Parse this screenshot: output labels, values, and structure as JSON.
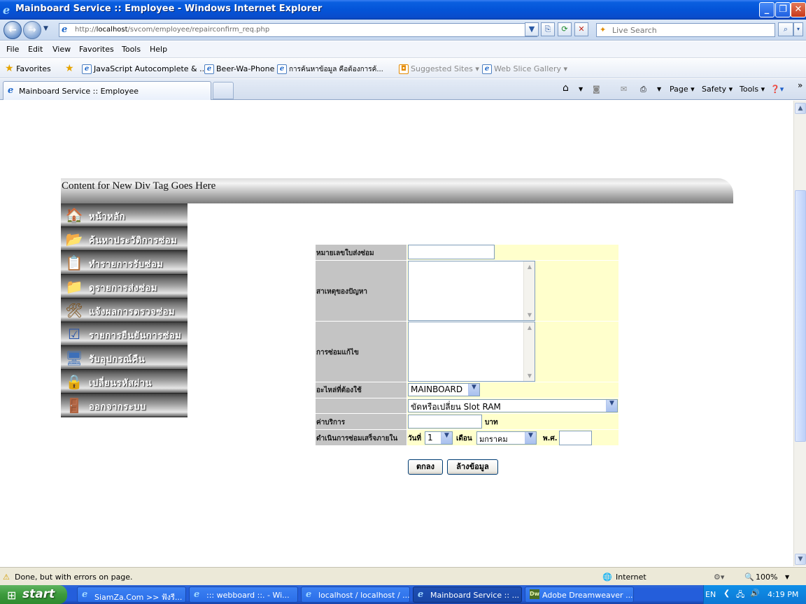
{
  "window": {
    "title": "Mainboard Service :: Employee - Windows Internet Explorer",
    "controls": [
      "minimize",
      "maximize",
      "close"
    ]
  },
  "address_bar": {
    "url_prefix": "http://",
    "url_host": "localhost",
    "url_path": "/svcom/employee/repairconfirm_req.php",
    "search_placeholder": "Live Search"
  },
  "menu": [
    "File",
    "Edit",
    "View",
    "Favorites",
    "Tools",
    "Help"
  ],
  "favorites_bar": {
    "favorites_label": "Favorites",
    "items": [
      "JavaScript Autocomplete & ...",
      "Beer-Wa-Phone",
      "การค้นหาข้อมูล คือต้องการค้...",
      "Suggested Sites ▾",
      "Web Slice Gallery ▾"
    ]
  },
  "tab": {
    "title": "Mainboard Service :: Employee"
  },
  "command_bar": [
    "Page ▾",
    "Safety ▾",
    "Tools ▾"
  ],
  "page": {
    "header_text": "Content for New Div Tag Goes Here",
    "side_menu": [
      {
        "label": "หน้าหลัก",
        "icon": "home-icon"
      },
      {
        "label": "ค้นหาประวัติการซ่อม",
        "icon": "folder-search-icon"
      },
      {
        "label": "ทำรายการรับซ่อม",
        "icon": "document-icon"
      },
      {
        "label": "ดูรายการส่งซ่อม",
        "icon": "open-folder-icon"
      },
      {
        "label": "แจ้งผลการตรวจซ่อม",
        "icon": "tools-icon"
      },
      {
        "label": "รายการยืนยันการซ่อม",
        "icon": "checklist-icon"
      },
      {
        "label": "รับอุปกรณ์คืน",
        "icon": "computer-icon"
      },
      {
        "label": "เปลี่ยนรหัสผ่าน",
        "icon": "lock-icon"
      },
      {
        "label": "ออกจากระบบ",
        "icon": "exit-door-icon"
      }
    ],
    "form": {
      "labels": {
        "repair_no": "หมายเลขใบส่งซ่อม",
        "cause": "สาเหตุของปัญหา",
        "fix": "การซ่อมแก้ไข",
        "parts": "อะไหล่ที่ต้องใช้",
        "service_fee": "ค่าบริการ",
        "complete_within": "ดำเนินการซ่อมเสร็จภายใน"
      },
      "values": {
        "repair_no": "",
        "cause": "",
        "fix": "",
        "service_fee": ""
      },
      "part_category": "MAINBOARD",
      "part_detail": "ขัดหรือเปลี่ยน Slot RAM",
      "currency_unit": "บาท",
      "date": {
        "day_label": "วันที่",
        "day": "1",
        "month_label": "เดือน",
        "month": "มกราคม",
        "year_label": "พ.ศ.",
        "year": ""
      },
      "buttons": {
        "submit": "ตกลง",
        "reset": "ล้างข้อมูล"
      }
    }
  },
  "status_bar": {
    "message": "Done, but with errors on page.",
    "zone": "Internet",
    "zoom": "100%"
  },
  "taskbar": {
    "start_label": "start",
    "tasks": [
      "SiamZa.Com >> ฟังรี...",
      "::: webboard ::. - Wi...",
      "localhost / localhost / ...",
      "Mainboard Service :: ...",
      "Adobe Dreamweaver ..."
    ],
    "active_task_index": 3,
    "language": "EN",
    "clock": "4:19 PM"
  }
}
